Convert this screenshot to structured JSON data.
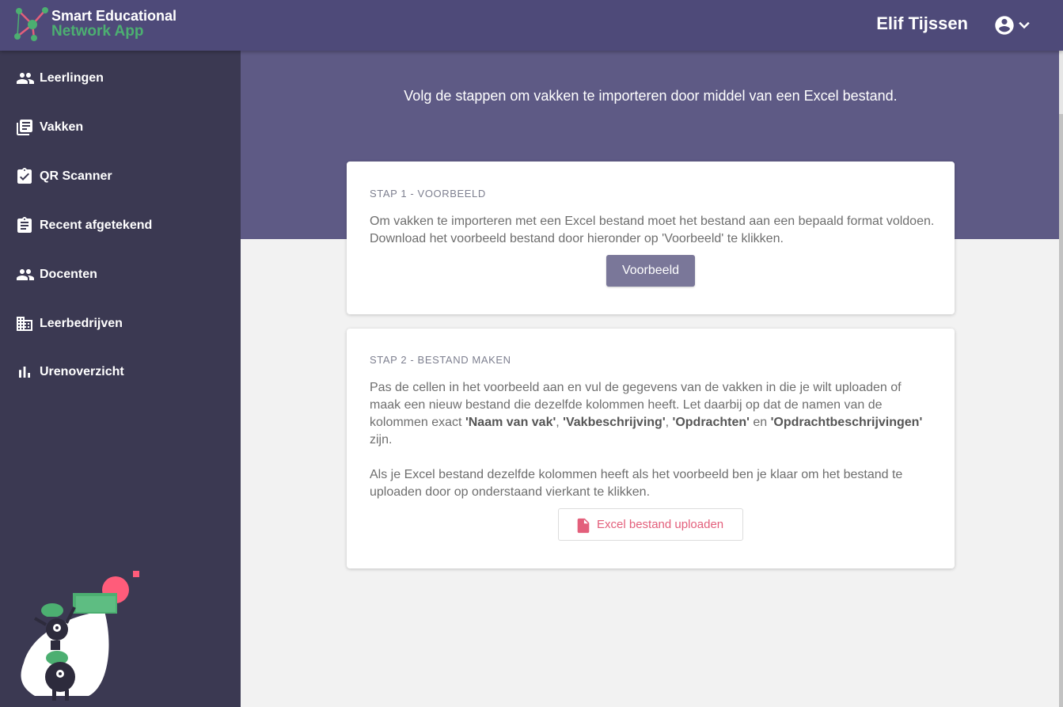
{
  "app": {
    "name_line1": "Smart Educational",
    "name_line2": "Network App"
  },
  "user": {
    "name": "Elif Tijssen"
  },
  "sidebar": {
    "items": [
      {
        "label": "Leerlingen",
        "icon": "people-icon"
      },
      {
        "label": "Vakken",
        "icon": "library-books-icon"
      },
      {
        "label": "QR Scanner",
        "icon": "clipboard-check-icon"
      },
      {
        "label": "Recent afgetekend",
        "icon": "clipboard-text-icon"
      },
      {
        "label": "Docenten",
        "icon": "people-icon"
      },
      {
        "label": "Leerbedrijven",
        "icon": "building-icon"
      },
      {
        "label": "Urenoverzicht",
        "icon": "bar-chart-icon"
      }
    ]
  },
  "hero": {
    "text": "Volg de stappen om vakken te importeren door middel van een Excel bestand."
  },
  "step1": {
    "title": "STAP 1 - VOORBEELD",
    "text": "Om vakken te importeren met een Excel bestand moet het bestand aan een bepaald format voldoen. Download het voorbeeld bestand door hieronder op 'Voorbeeld' te klikken.",
    "button_label": "Voorbeeld"
  },
  "step2": {
    "title": "STAP 2 - BESTAND MAKEN",
    "text_intro": "Pas de cellen in het voorbeeld aan en vul de gegevens van de vakken in die je wilt uploaden of maak een nieuw bestand die dezelfde kolommen heeft. Let daarbij op dat de namen van de kolommen exact ",
    "col1": "'Naam van vak'",
    "sep1": ", ",
    "col2": "'Vakbeschrijving'",
    "sep2": ", ",
    "col3": "'Opdrachten'",
    "sep3": " en ",
    "col4": "'Opdrachtbeschrijvingen'",
    "text_end": " zijn.",
    "text2": "Als je Excel bestand dezelfde kolommen heeft als het voorbeeld ben je klaar om het bestand te uploaden door op onderstaand vierkant te klikken.",
    "upload_label": "Excel bestand uploaden"
  },
  "colors": {
    "topbar": "#4e4a79",
    "sidebar": "#3b3952",
    "hero": "#5e5a85",
    "accent_green": "#4caf71",
    "upload_red": "#e35f7b",
    "button": "#7a7799"
  }
}
